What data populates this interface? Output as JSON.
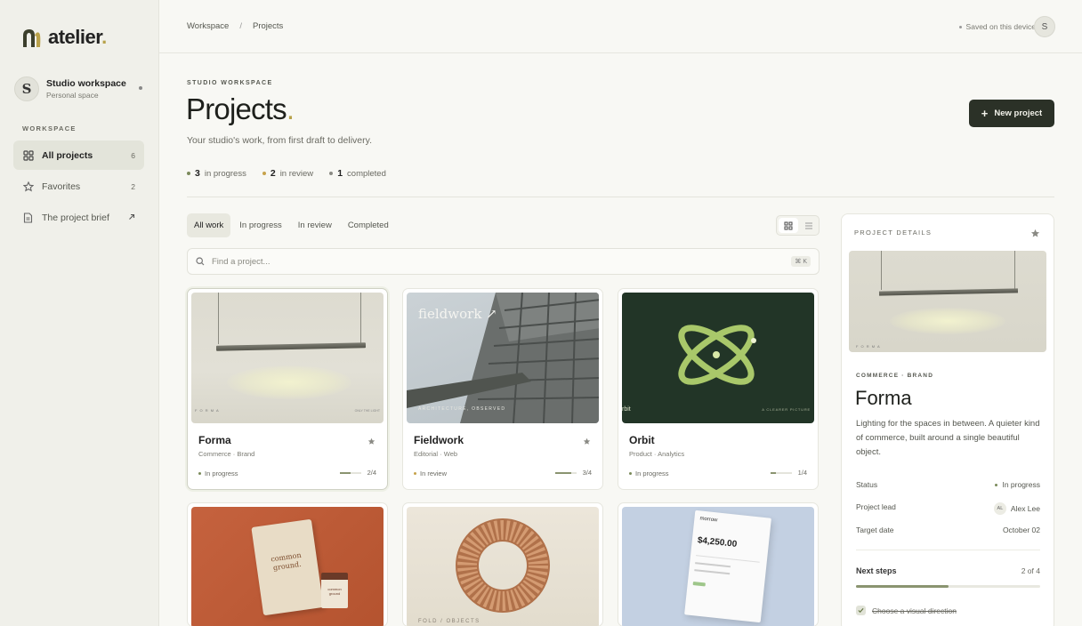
{
  "app": {
    "logo_text": "atelier",
    "logo_dot": "."
  },
  "workspace": {
    "name": "Studio workspace",
    "sub": "Personal space",
    "avatar": "S"
  },
  "sidebar": {
    "section": "WORKSPACE",
    "items": [
      {
        "label": "All projects",
        "count": "6",
        "icon": "grid-icon"
      },
      {
        "label": "Favorites",
        "count": "2",
        "icon": "star-icon"
      },
      {
        "label": "The project brief",
        "icon": "document-icon"
      }
    ]
  },
  "topbar": {
    "crumbs": [
      "Workspace",
      "/",
      "Projects"
    ],
    "saved": "Saved on this device",
    "avatar": "S"
  },
  "page": {
    "eyebrow": "STUDIO WORKSPACE",
    "title": "Projects",
    "title_dot": ".",
    "subtitle": "Your studio's work, from first draft to delivery.",
    "new_button": "New project"
  },
  "stats": [
    {
      "count": "3",
      "label": "in progress",
      "color": "#7c8a5c"
    },
    {
      "count": "2",
      "label": "in review",
      "color": "#c6a24a"
    },
    {
      "count": "1",
      "label": "completed",
      "color": "#8a8a84"
    }
  ],
  "tabs": [
    "All work",
    "In progress",
    "In review",
    "Completed"
  ],
  "search": {
    "placeholder": "Find a project...",
    "shortcut": "⌘ K"
  },
  "projects": [
    {
      "name": "Forma",
      "tags": "Commerce · Brand",
      "status": "In progress",
      "progress": "2/4",
      "progress_frac": 0.5,
      "thumb_left": "F O R M A",
      "thumb_right": "ONLY THE LIGHT"
    },
    {
      "name": "Fieldwork",
      "tags": "Editorial · Web",
      "status": "In review",
      "progress": "3/4",
      "progress_frac": 0.75,
      "thumb_title": "fieldwork ↗",
      "thumb_caption": "ARCHITECTURE, OBSERVED"
    },
    {
      "name": "Orbit",
      "tags": "Product · Analytics",
      "status": "In progress",
      "progress": "1/4",
      "progress_frac": 0.25,
      "thumb_left": "rbit",
      "thumb_right": "A CLEARER PICTURE"
    }
  ],
  "row2": {
    "common_ground": "common ground.",
    "cup": "common ground",
    "fold": "FOLD / OBJECTS",
    "invoice_brand": "morrow",
    "invoice_amount": "$4,250.00"
  },
  "details": {
    "header": "PROJECT DETAILS",
    "category": "COMMERCE · BRAND",
    "name": "Forma",
    "description": "Lighting for the spaces in between. A quieter kind of commerce, built around a single beautiful object.",
    "status_label": "Status",
    "status_value": "In progress",
    "lead_label": "Project lead",
    "lead_initials": "AL",
    "lead_value": "Alex Lee",
    "target_label": "Target date",
    "target_value": "October 02",
    "next_steps": "Next steps",
    "next_count": "2 of 4",
    "next_frac": 0.5,
    "step1": "Choose a visual direction",
    "image_caption": "F O R M A"
  }
}
